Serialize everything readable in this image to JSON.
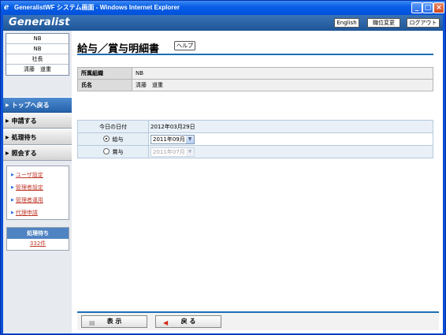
{
  "window": {
    "title": "GeneralistWF システム画面 - Windows Internet Explorer"
  },
  "header": {
    "logo": "Generalist",
    "english_label": "English",
    "position_change_label": "職位変更",
    "logout_label": "ログアウト"
  },
  "sidebar": {
    "user_info": [
      "NB",
      "NB",
      "社長",
      "清藤　道重"
    ],
    "nav": {
      "top": "トップへ戻る",
      "apply": "申請する",
      "pending": "処理待ち",
      "inquiry": "照会する"
    },
    "links": [
      "ユーザ設定",
      "管理者設定",
      "管理者運用",
      "代理申請"
    ],
    "pending_box": {
      "title": "処理待ち",
      "count": "332件"
    }
  },
  "main": {
    "title": "給与／賞与明細書",
    "help_label": "ヘルプ",
    "info": {
      "org_label": "所属組織",
      "org_value": "NB",
      "name_label": "氏名",
      "name_value": "清藤　道重"
    },
    "date_table": {
      "today_label": "今日の日付",
      "today_value": "2012年03月29日",
      "salary_label": "給与",
      "salary_selected": "2011年09月",
      "bonus_label": "賞与",
      "bonus_selected": "2011年07月"
    },
    "footer": {
      "display_label": "表 示",
      "back_label": "戻 る"
    }
  },
  "colors": {
    "accent": "#1e6fb5",
    "header": "#2a62a4",
    "link": "#c0392b"
  }
}
